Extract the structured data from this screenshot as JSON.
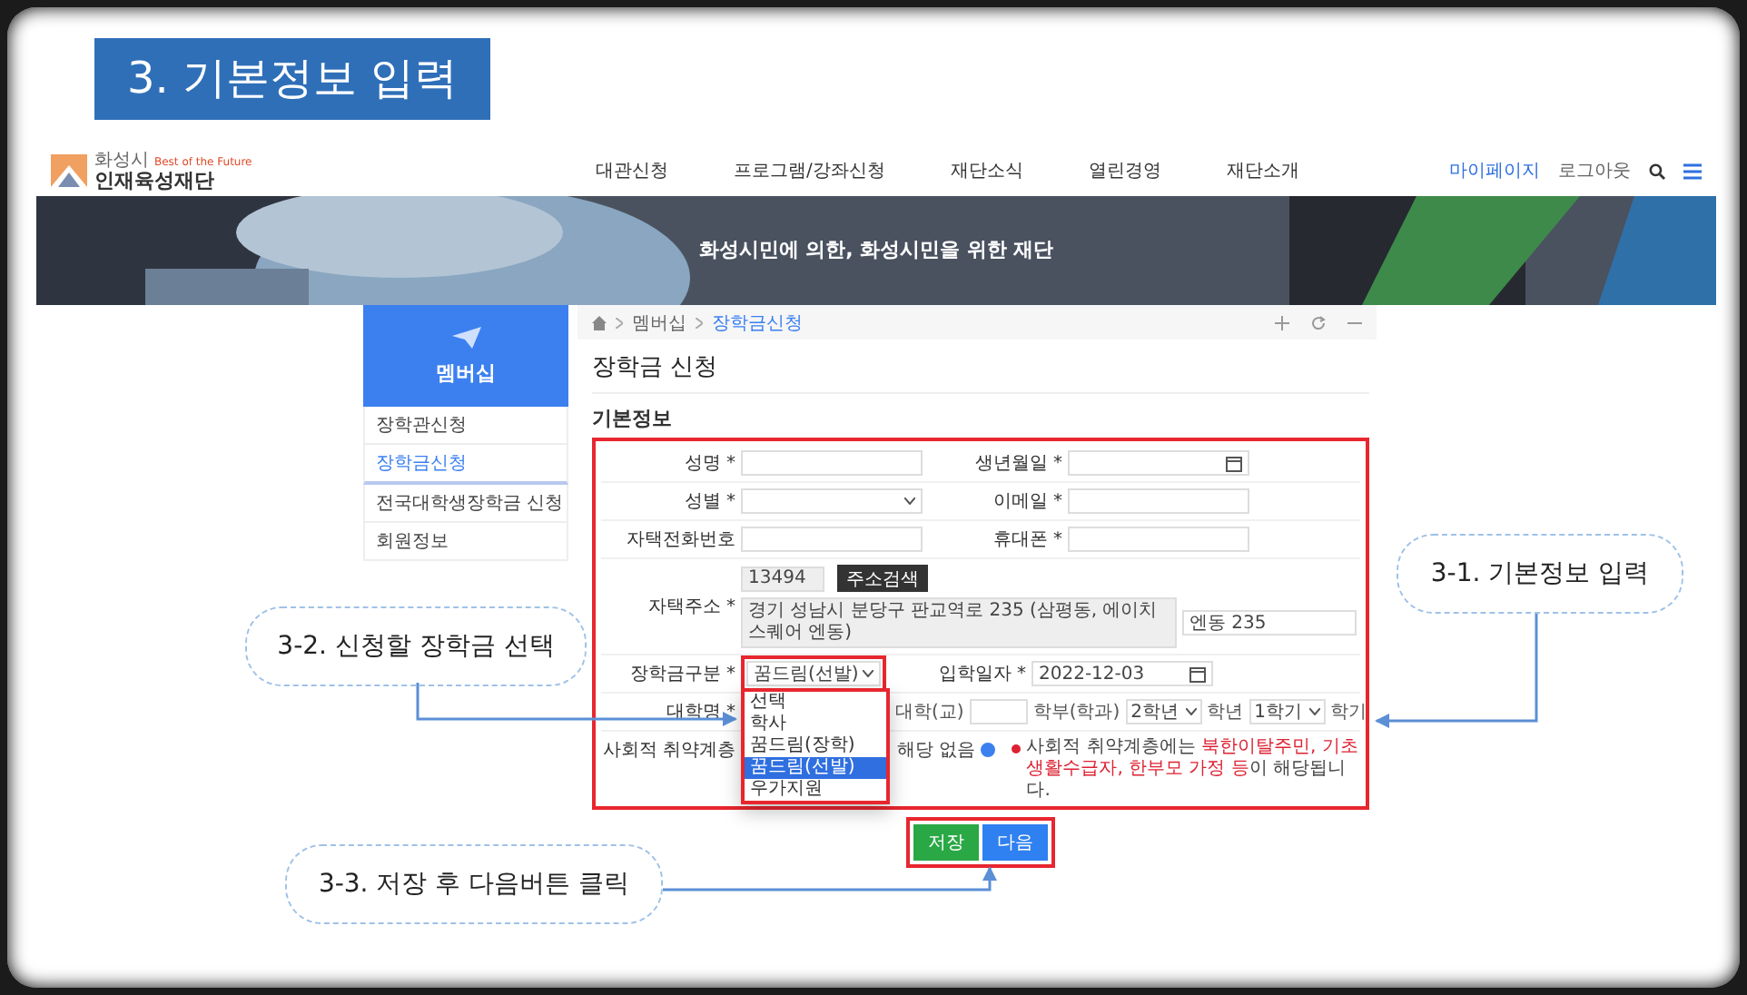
{
  "slide_title": "3. 기본정보 입력",
  "header": {
    "logo_top": "화성시",
    "logo_tagline": "Best of the Future",
    "logo_name": "인재육성재단",
    "nav": [
      "대관신청",
      "프로그램/강좌신청",
      "재단소식",
      "열린경영",
      "재단소개"
    ],
    "links": [
      {
        "label": "마이페이지",
        "selected": true
      },
      {
        "label": "로그아웃",
        "selected": false
      }
    ]
  },
  "banner": {
    "text": "화성시민에 의한, 화성시민을 위한 재단"
  },
  "sidebar": {
    "title": "멤버십",
    "items": [
      {
        "label": "장학관신청",
        "selected": false
      },
      {
        "label": "장학금신청",
        "selected": true
      },
      {
        "label": "전국대학생장학금 신청",
        "selected": false
      },
      {
        "label": "회원정보",
        "selected": false
      }
    ]
  },
  "breadcrumb": [
    {
      "label": "멤버십",
      "selected": false
    },
    {
      "label": "장학금신청",
      "selected": true
    }
  ],
  "page_title": "장학금 신청",
  "section_title": "기본정보",
  "form": {
    "rows": [
      {
        "fields": [
          {
            "kind": "text",
            "label": "성명 *"
          },
          {
            "kind": "date",
            "label": "생년월일 *"
          }
        ]
      },
      {
        "fields": [
          {
            "kind": "select",
            "label": "성별 *"
          },
          {
            "kind": "text",
            "label": "이메일 *"
          }
        ]
      },
      {
        "fields": [
          {
            "kind": "text",
            "label": "자택전화번호"
          },
          {
            "kind": "text",
            "label": "휴대폰 *"
          }
        ]
      }
    ],
    "address": {
      "label": "자택주소 *",
      "postcode": "13494",
      "search_button": "주소검색",
      "address": "경기 성남시 분당구 판교역로 235 (삼평동, 에이치스퀘어 엔동)",
      "detail": "엔동 235"
    },
    "scholarship": {
      "label": "장학금구분 *",
      "value": "꿈드림(선발)",
      "expanded": true,
      "options": [
        {
          "label": "선택",
          "selected": false
        },
        {
          "label": "학사",
          "selected": false
        },
        {
          "label": "꿈드림(장학)",
          "selected": false
        },
        {
          "label": "꿈드림(선발)",
          "selected": true
        },
        {
          "label": "우가지원",
          "selected": false
        }
      ]
    },
    "entry_date": {
      "label": "입학일자 *",
      "value": "2022-12-03"
    },
    "university": {
      "label": "대학명 *",
      "school_suffix": "대학(교)",
      "dept_suffix": "학부(학과)",
      "grade": "2학년",
      "grade_unit": "학년",
      "semester": "1학기",
      "semester_unit": "학기"
    },
    "vulnerable": {
      "label": "사회적 취약계층",
      "option": "해당 없음",
      "checked": true,
      "note_start": "사회적 취약계층에는 ",
      "note_highlight": "북한이탈주민, 기초생활수급자, 한부모 가정 등",
      "note_end": "이 해당됩니다."
    }
  },
  "buttons": [
    {
      "kind": "save",
      "label": "저장"
    },
    {
      "kind": "next",
      "label": "다음"
    }
  ],
  "callouts": [
    {
      "kind": "right",
      "text": "3-1. 기본정보 입력"
    },
    {
      "kind": "left",
      "text": "3-2. 신청할 장학금 선택"
    },
    {
      "kind": "bottom",
      "text": "3-3. 저장 후 다음버튼 클릭"
    }
  ]
}
